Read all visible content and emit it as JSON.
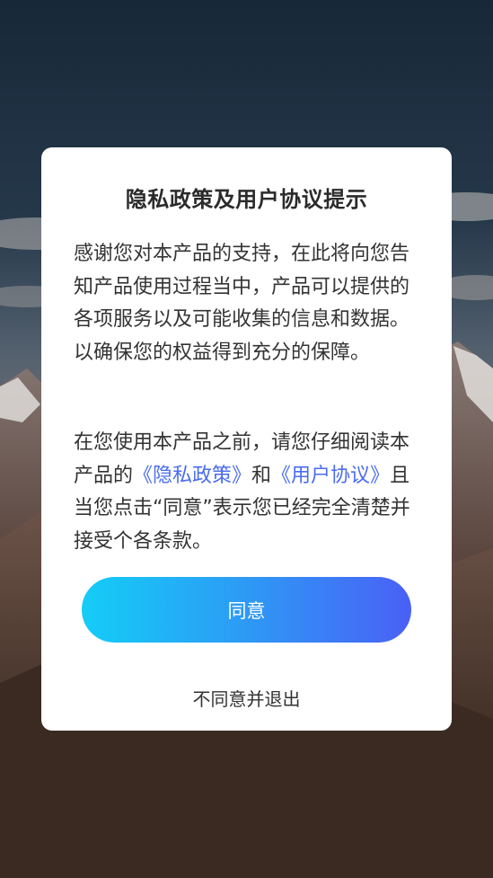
{
  "dialog": {
    "title": "隐私政策及用户协议提示",
    "paragraph1": "感谢您对本产品的支持，在此将向您告知产品使用过程当中，产品可以提供的各项服务以及可能收集的信息和数据。以确保您的权益得到充分的保障。",
    "paragraph2_prefix": "在您使用本产品之前，请您仔细阅读本产品的",
    "privacy_link": "《隐私政策》",
    "paragraph2_and": "和",
    "user_agreement_link": "《用户协议》",
    "paragraph2_suffix": "且当您点击“同意”表示您已经完全清楚并接受个各条款。",
    "agree_label": "同意",
    "disagree_label": "不同意并退出"
  },
  "colors": {
    "link": "#4a6cf0",
    "button_gradient_start": "#14cdf7",
    "button_gradient_end": "#4a60f6"
  }
}
